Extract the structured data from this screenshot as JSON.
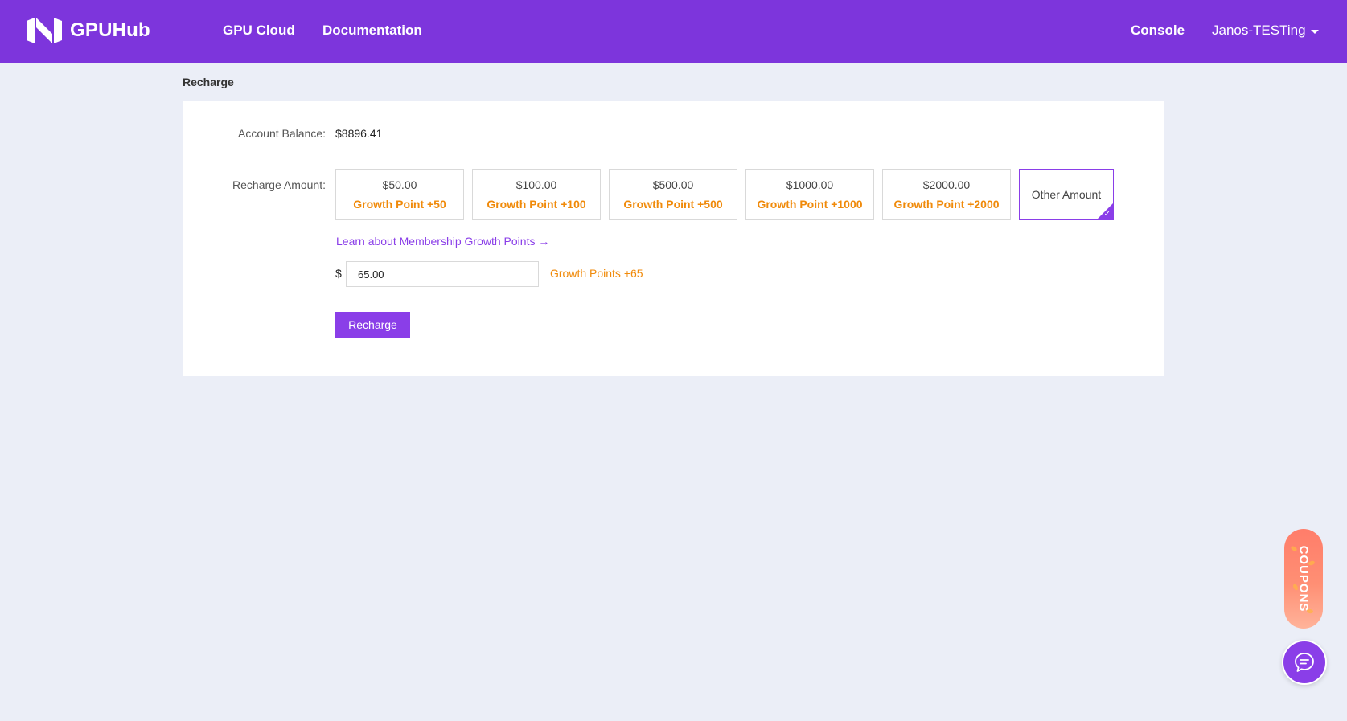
{
  "header": {
    "brand": "GPUHub",
    "nav": {
      "gpu_cloud": "GPU Cloud",
      "documentation": "Documentation"
    },
    "console": "Console",
    "user": "Janos-TESTing"
  },
  "page": {
    "title": "Recharge"
  },
  "balance": {
    "label": "Account Balance:",
    "value": "$8896.41"
  },
  "recharge": {
    "label": "Recharge Amount:",
    "options": [
      {
        "price": "$50.00",
        "points": "Growth Point +50"
      },
      {
        "price": "$100.00",
        "points": "Growth Point +100"
      },
      {
        "price": "$500.00",
        "points": "Growth Point +500"
      },
      {
        "price": "$1000.00",
        "points": "Growth Point +1000"
      },
      {
        "price": "$2000.00",
        "points": "Growth Point +2000"
      }
    ],
    "other": "Other Amount",
    "learn_link": "Learn about Membership Growth Points →",
    "currency": "$",
    "input_value": "65.00",
    "points_hint": "Growth Points +65",
    "button": "Recharge"
  },
  "floating": {
    "coupons": "COUPONS"
  },
  "colors": {
    "brand": "#7d35dc",
    "accent": "#8a3ee8",
    "points": "#f08a0a",
    "background": "#ebeef7"
  }
}
